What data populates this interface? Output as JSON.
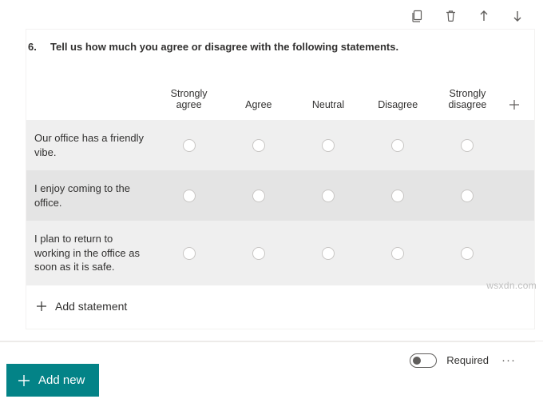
{
  "toolbar": {
    "icons": [
      "copy",
      "delete",
      "move-up",
      "move-down"
    ]
  },
  "question": {
    "number": "6.",
    "text": "Tell us how much you agree or disagree with the following statements."
  },
  "scale": [
    "Strongly agree",
    "Agree",
    "Neutral",
    "Disagree",
    "Strongly disagree"
  ],
  "statements": [
    "Our office has a friendly vibe.",
    "I enjoy coming to the office.",
    "I plan to return to working in the office as soon as it is safe."
  ],
  "add_statement_label": "Add statement",
  "footer": {
    "required_label": "Required"
  },
  "add_new_label": "Add new",
  "watermark": "wsxdn.com"
}
